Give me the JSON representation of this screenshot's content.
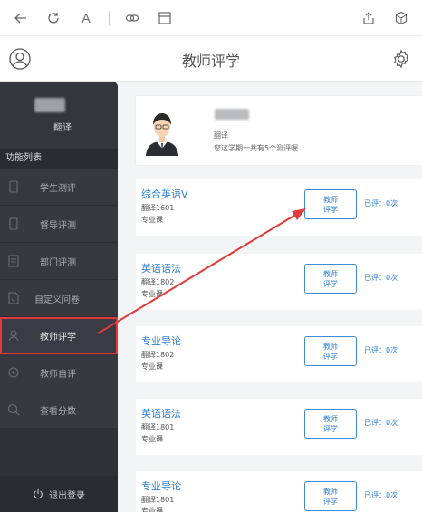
{
  "app": {
    "title": "教师评学",
    "accent": "#2f7fd4",
    "highlight": "#e23a3a"
  },
  "toolbar": {
    "text_size_glyph": "A"
  },
  "sidebar": {
    "user_role": "翻译",
    "section_label": "功能列表",
    "items": [
      {
        "label": "学生测评",
        "icon": "phone-icon"
      },
      {
        "label": "督导评测",
        "icon": "phone-icon"
      },
      {
        "label": "部门评测",
        "icon": "document-icon"
      },
      {
        "label": "自定义问卷",
        "icon": "survey-icon"
      },
      {
        "label": "教师评学",
        "icon": "teacher-icon",
        "active": true
      },
      {
        "label": "教师自评",
        "icon": "self-eval-icon"
      },
      {
        "label": "查看分数",
        "icon": "score-search-icon"
      }
    ],
    "logout_label": "退出登录"
  },
  "profile": {
    "role": "翻译",
    "note": "您这学期一共有5个测评喔"
  },
  "courses": [
    {
      "name": "综合英语V",
      "class": "翻译1601",
      "type": "专业课",
      "button": [
        "教师",
        "评学"
      ],
      "status": "已评：0次"
    },
    {
      "name": "英语语法",
      "class": "翻译1802",
      "type": "专业课",
      "button": [
        "教师",
        "评学"
      ],
      "status": "已评：0次"
    },
    {
      "name": "专业导论",
      "class": "翻译1802",
      "type": "专业课",
      "button": [
        "教师",
        "评学"
      ],
      "status": "已评：0次"
    },
    {
      "name": "英语语法",
      "class": "翻译1801",
      "type": "专业课",
      "button": [
        "教师",
        "评学"
      ],
      "status": "已评：0次"
    },
    {
      "name": "专业导论",
      "class": "翻译1801",
      "type": "专业课",
      "button": [
        "教师",
        "评学"
      ],
      "status": "已评：0次"
    }
  ]
}
